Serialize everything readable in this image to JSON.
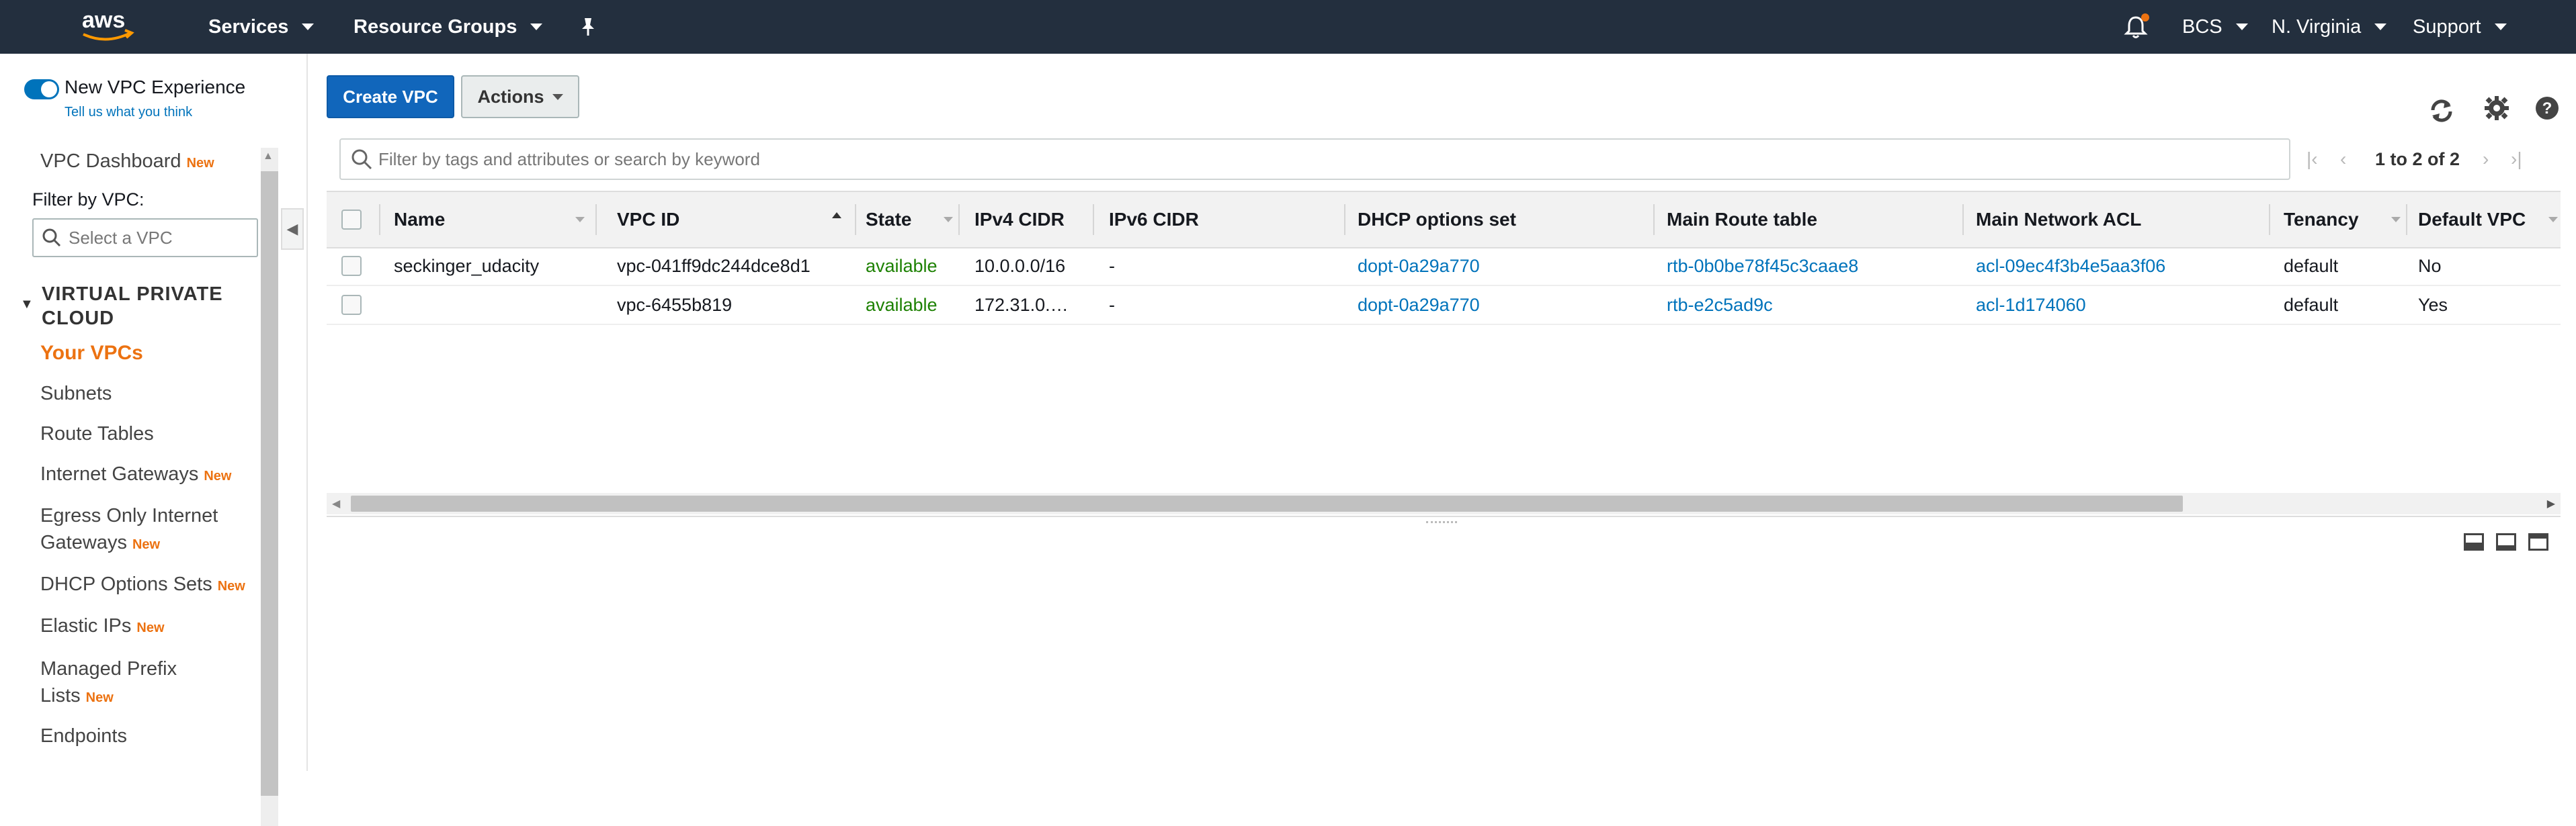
{
  "topbar": {
    "logo": "aws",
    "services": "Services",
    "resource_groups": "Resource Groups",
    "account": "BCS",
    "region": "N. Virginia",
    "support": "Support",
    "icons": [
      "pin-icon",
      "bell-icon"
    ],
    "notification_dot_color": "#ec7211",
    "background_color": "#232f3e"
  },
  "sidebar": {
    "new_experience_label": "New VPC Experience",
    "feedback_link": "Tell us what you think",
    "dashboard": "VPC Dashboard",
    "new_badge": "New",
    "filter_label": "Filter by VPC:",
    "filter_placeholder": "Select a VPC",
    "section_title": "VIRTUAL PRIVATE CLOUD",
    "items": [
      {
        "label": "Your VPCs",
        "new": false,
        "active": true
      },
      {
        "label": "Subnets",
        "new": false
      },
      {
        "label": "Route Tables",
        "new": false
      },
      {
        "label": "Internet Gateways",
        "new": true
      },
      {
        "label": "Egress Only Internet Gateways",
        "line1": "Egress Only Internet",
        "line2": "Gateways",
        "new": true
      },
      {
        "label": "DHCP Options Sets",
        "new": true
      },
      {
        "label": "Elastic IPs",
        "new": true
      },
      {
        "label": "Managed Prefix Lists",
        "line1": "Managed Prefix",
        "line2": "Lists",
        "new": true
      },
      {
        "label": "Endpoints",
        "new": false
      }
    ],
    "accent_color": "#ec7211"
  },
  "toolbar": {
    "create_label": "Create VPC",
    "actions_label": "Actions",
    "icons": [
      "refresh-icon",
      "settings-gear-icon",
      "help-icon"
    ]
  },
  "search": {
    "placeholder": "Filter by tags and attributes or search by keyword"
  },
  "pagination": {
    "text": "1 to 2 of 2"
  },
  "table": {
    "columns": [
      "Name",
      "VPC ID",
      "State",
      "IPv4 CIDR",
      "IPv6 CIDR",
      "DHCP options set",
      "Main Route table",
      "Main Network ACL",
      "Tenancy",
      "Default VPC"
    ],
    "rows": [
      {
        "name": "seckinger_udacity",
        "vpc_id": "vpc-041ff9dc244dce8d1",
        "state": "available",
        "ipv4": "10.0.0.0/16",
        "ipv6": "-",
        "dhcp": "dopt-0a29a770",
        "route_table": "rtb-0b0be78f45c3caae8",
        "acl": "acl-09ec4f3b4e5aa3f06",
        "tenancy": "default",
        "default_vpc": "No"
      },
      {
        "name": "",
        "vpc_id": "vpc-6455b819",
        "state": "available",
        "ipv4": "172.31.0.…",
        "ipv6": "-",
        "dhcp": "dopt-0a29a770",
        "route_table": "rtb-e2c5ad9c",
        "acl": "acl-1d174060",
        "tenancy": "default",
        "default_vpc": "Yes"
      }
    ],
    "link_color": "#0073bb",
    "state_color": "#1d8102"
  }
}
